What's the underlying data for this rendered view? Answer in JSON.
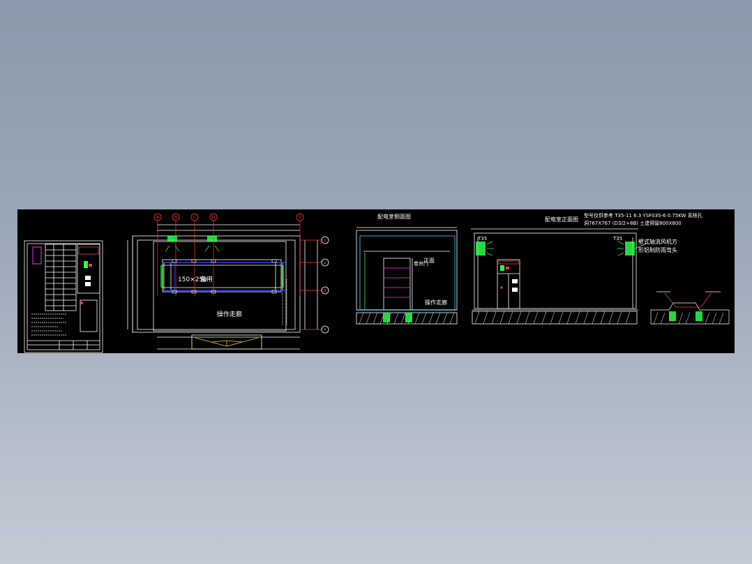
{
  "drawing": {
    "grid_axes": [
      "A",
      "B",
      "C",
      "D",
      "E"
    ],
    "row_axes": [
      "1",
      "2",
      "3",
      "4"
    ],
    "plan_labels": {
      "cable_trench": "150×250",
      "spare": "备用",
      "corridor": "操作走廊"
    },
    "section_side": {
      "title": "配电室侧面图",
      "front_label": "正面",
      "door_label": "卷帘门",
      "corridor": "操作走廊"
    },
    "section_front": {
      "title": "配电室正面图",
      "fan_label": "T35",
      "note_lines": [
        "型号仅供参考 T35-11  6.3  YSF03S-6 0.75KW 系除孔",
        "洞767X767 (D3/2+8B) 土建预留800X800"
      ],
      "fan_callout_lines": [
        "壁式轴流风机方",
        "形铝制防雨弯头"
      ]
    },
    "colors": {
      "background": "#000000",
      "lines": "#ffffff",
      "accent_red": "#ff3b3b",
      "accent_blue": "#2a3cff",
      "accent_green": "#2bff4a",
      "accent_yellow": "#ffd400",
      "accent_magenta": "#ff2bff",
      "accent_cyan": "#3ad6ff"
    }
  }
}
